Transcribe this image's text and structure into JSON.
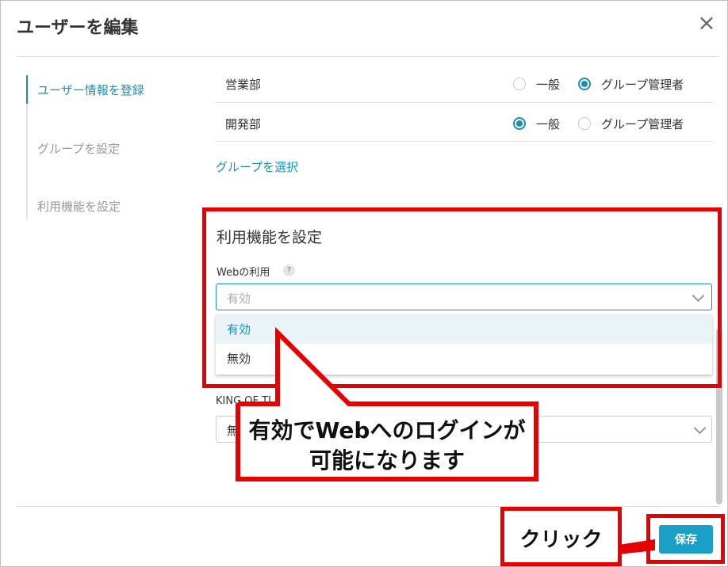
{
  "dialog": {
    "title": "ユーザーを編集",
    "close_icon": "×"
  },
  "steps": [
    {
      "label": "ユーザー情報を登録",
      "active": true
    },
    {
      "label": "グループを設定",
      "active": false
    },
    {
      "label": "利用機能を設定",
      "active": false
    }
  ],
  "groups": [
    {
      "name": "営業部",
      "options": [
        "一般",
        "グループ管理者"
      ],
      "selected": "グループ管理者"
    },
    {
      "name": "開発部",
      "options": [
        "一般",
        "グループ管理者"
      ],
      "selected": "一般"
    }
  ],
  "select_group_link": "グループを選択",
  "features": {
    "section_title": "利用機能を設定",
    "web_label": "Webの利用",
    "help_icon": "?",
    "web_placeholder": "有効",
    "dropdown_options": [
      "有効",
      "無効"
    ],
    "highlighted_option": "有効",
    "next_label_partial": "KING OF TI",
    "next_value_partial": "無"
  },
  "footer": {
    "save_label": "保存"
  },
  "annotations": {
    "callout_line1": "有効でWebへのログインが",
    "callout_line2": "可能になります",
    "click_label": "クリック",
    "color": "#e60000"
  }
}
